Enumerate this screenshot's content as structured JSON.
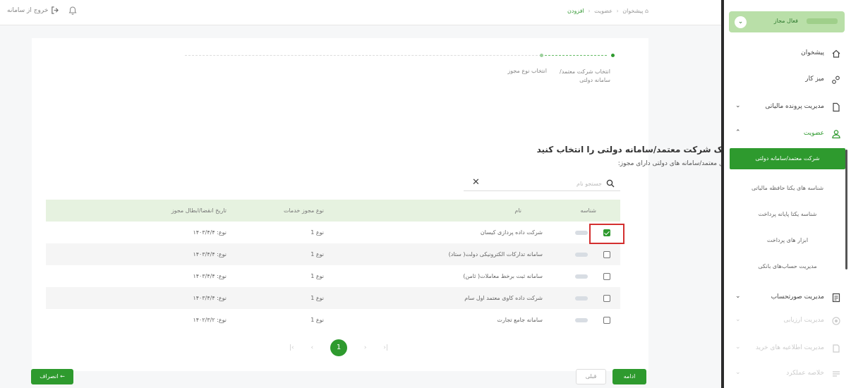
{
  "topbar": {
    "logout_label": "خروج از سامانه",
    "breadcrumb": [
      "پیشخوان",
      "عضویت",
      "افزودن"
    ],
    "breadcrumb_sep": "‹"
  },
  "stepper": {
    "steps": [
      "انتخاب شرکت معتمد/ سامانه دولتی",
      "انتخاب نوع مجوز",
      ""
    ]
  },
  "form": {
    "title": "لطفا یک شرکت معتمد/سامانه دولتی را انتخاب کنید",
    "subtitle": "شرکت های معتمد/سامانه های دولتی دارای مجوز:",
    "search_placeholder": "جستجو نام",
    "clear_symbol": "✕"
  },
  "table": {
    "headers": {
      "id": "شناسه",
      "name": "نام",
      "license_type": "نوع مجوز خدمات",
      "expiry": "تاریخ انقضا/ابطال مجوز"
    },
    "rows": [
      {
        "name": "شرکت داده پردازی کیسان",
        "license_type": "نوع 1",
        "expiry": "نوع: ۱۴۰۳/۴/۴",
        "checked": true
      },
      {
        "name": "سامانه تدارکات الکترونیکی دولت( ستاد)",
        "license_type": "نوع 1",
        "expiry": "نوع: ۱۴۰۳/۴/۴",
        "checked": false
      },
      {
        "name": "سامانه ثبت برخط معاملات( ثامن)",
        "license_type": "نوع 1",
        "expiry": "نوع: ۱۴۰۳/۴/۴",
        "checked": false
      },
      {
        "name": "شرکت داده کاوی معتمد اول سام",
        "license_type": "نوع 1",
        "expiry": "نوع: ۱۴۰۳/۴/۴",
        "checked": false
      },
      {
        "name": "سامانه جامع تجارت",
        "license_type": "نوع 1",
        "expiry": "نوع: ۱۴۰۲/۳/۲",
        "checked": false
      }
    ]
  },
  "pager": {
    "current": "1",
    "first": "|‹",
    "prev": "‹",
    "next": "›",
    "last": "›|"
  },
  "buttons": {
    "cancel": "انصراف ←",
    "prev": "قبلی",
    "next": "ادامه"
  },
  "sidebar": {
    "user_role": "فعال مجاز",
    "user_chevron": "⌄",
    "items": [
      {
        "label": "پیشخوان",
        "icon": "home-icon",
        "chevron": ""
      },
      {
        "label": "میز کار",
        "icon": "workspace-icon",
        "chevron": ""
      },
      {
        "label": "مدیریت پرونده مالیاتی",
        "icon": "file-icon",
        "chevron": "⌄"
      },
      {
        "label": "عضویت",
        "icon": "user-icon",
        "chevron": "⌃"
      },
      {
        "label": "مدیریت صورتحساب",
        "icon": "invoice-icon",
        "chevron": "⌄"
      },
      {
        "label": "مدیریت ارزیابی",
        "icon": "assessment-icon",
        "chevron": "⌄"
      },
      {
        "label": "مدیریت اطلاعیه های خرید",
        "icon": "notice-icon",
        "chevron": "⌄"
      },
      {
        "label": "خلاصه عملکرد",
        "icon": "summary-icon",
        "chevron": "⌄"
      }
    ],
    "sub_items": [
      "شرکت معتمد/سامانه دولتی",
      "شناسه های یکتا حافظه مالیاتی",
      "شناسه یکتا پایانه پرداخت",
      "ابزار های پرداخت",
      "مدیریت حساب‌های بانکی"
    ]
  },
  "colors": {
    "accent": "#2e9a2e",
    "header_row": "#e6f2e0",
    "highlight": "#d32f2f"
  }
}
